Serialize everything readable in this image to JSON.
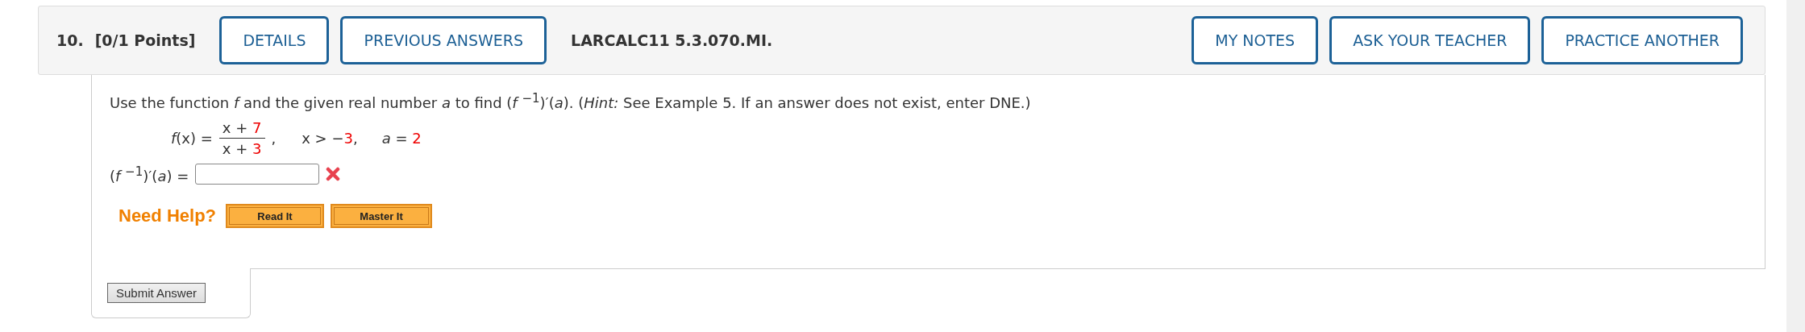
{
  "header": {
    "number": "10.",
    "points": "[0/1 Points]",
    "left_buttons": [
      "DETAILS",
      "PREVIOUS ANSWERS"
    ],
    "problem_id": "LARCALC11 5.3.070.MI.",
    "right_buttons": [
      "MY NOTES",
      "ASK YOUR TEACHER",
      "PRACTICE ANOTHER"
    ]
  },
  "question": {
    "prompt": "Use the function *f* and the given real number *a* to find (*f* $^{−1}$)′(*a*). (*Hint:* See Example 5. If an answer does not exist, enter DNE.)",
    "function_label": "*f*(x) =",
    "numerator": {
      "expression": "x + ",
      "constant": "7"
    },
    "denominator": {
      "expression": "x + ",
      "constant": "3"
    },
    "separator": ",",
    "condition": {
      "expression": "x > −",
      "constant": "3",
      "suffix": ","
    },
    "value": {
      "expression": "*a* = ",
      "constant": "2"
    },
    "answer_label": "(*f* $^{−1}$)′(*a*) =",
    "answer": {
      "correct": false
    }
  },
  "help": {
    "title": "Need Help?",
    "buttons": [
      "Read It",
      "Master It"
    ]
  },
  "submit": "Submit Answer"
}
